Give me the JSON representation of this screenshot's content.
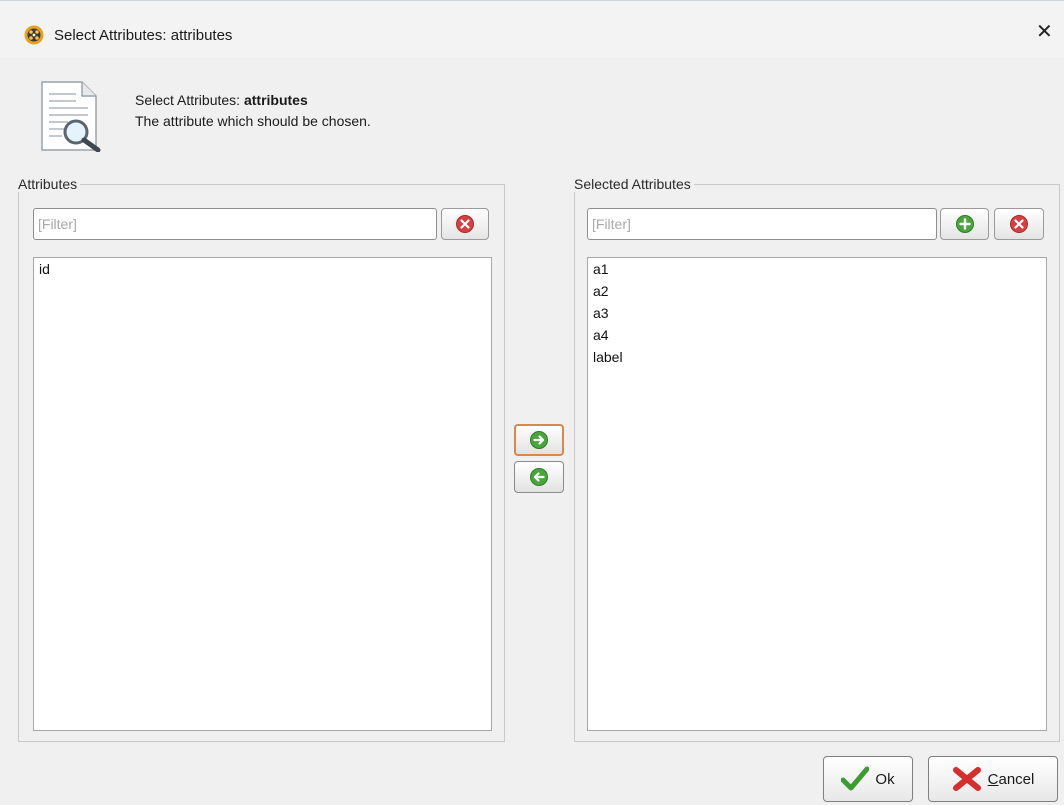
{
  "window": {
    "title": "Select Attributes: attributes",
    "close_glyph": "✕",
    "app_icon": "rapidminer-logo-icon"
  },
  "header": {
    "prefix": "Select Attributes: ",
    "param_name": "attributes",
    "description": "The attribute which should be chosen.",
    "icon": "document-magnifier-icon"
  },
  "left_panel": {
    "legend": "Attributes",
    "filter_placeholder": "[Filter]",
    "filter_value": "",
    "items": [
      "id"
    ]
  },
  "right_panel": {
    "legend": "Selected Attributes",
    "filter_placeholder": "[Filter]",
    "filter_value": "",
    "items": [
      "a1",
      "a2",
      "a3",
      "a4",
      "label"
    ]
  },
  "move": {
    "right_icon": "arrow-right-icon",
    "left_icon": "arrow-left-icon"
  },
  "buttons": {
    "ok": "Ok",
    "cancel_mnemonic": "C",
    "cancel_rest": "ancel"
  },
  "colors": {
    "green": "#4aa63c",
    "red": "#d64040",
    "focus_border": "#d9874a"
  }
}
